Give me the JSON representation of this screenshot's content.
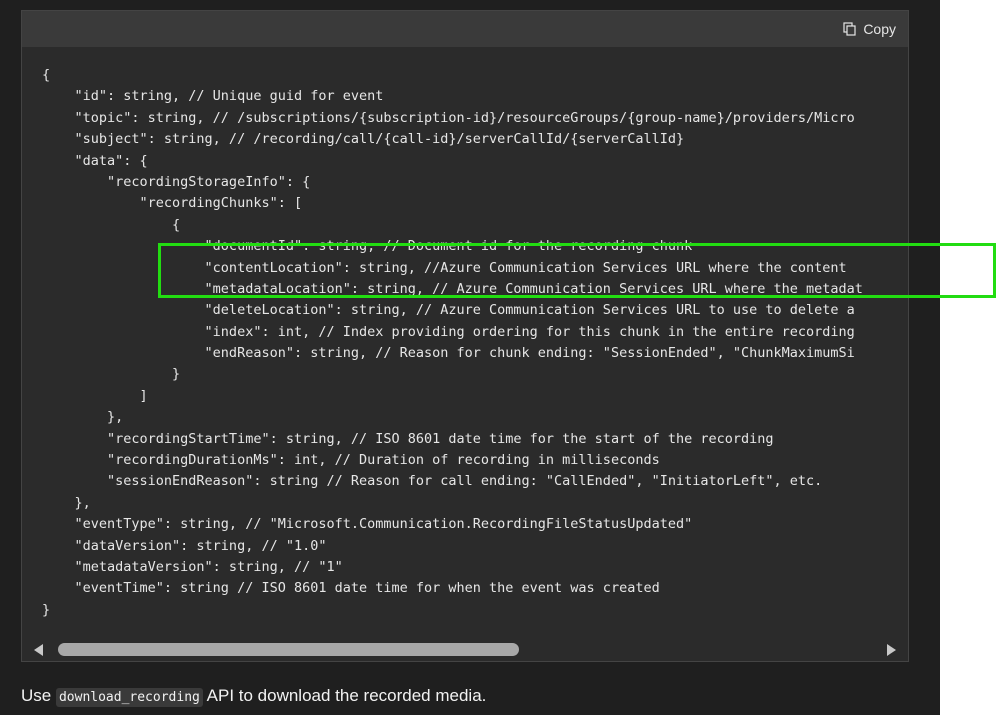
{
  "code_block": {
    "copy_label": "Copy",
    "copy_icon": "copy-icon",
    "lines": [
      "{",
      "    \"id\": string, // Unique guid for event",
      "    \"topic\": string, // /subscriptions/{subscription-id}/resourceGroups/{group-name}/providers/Micro",
      "    \"subject\": string, // /recording/call/{call-id}/serverCallId/{serverCallId}",
      "    \"data\": {",
      "        \"recordingStorageInfo\": {",
      "            \"recordingChunks\": [",
      "                {",
      "                    \"documentId\": string, // Document id for the recording chunk",
      "                    \"contentLocation\": string, //Azure Communication Services URL where the content",
      "                    \"metadataLocation\": string, // Azure Communication Services URL where the metadat",
      "                    \"deleteLocation\": string, // Azure Communication Services URL to use to delete a",
      "                    \"index\": int, // Index providing ordering for this chunk in the entire recording",
      "                    \"endReason\": string, // Reason for chunk ending: \"SessionEnded\", \"ChunkMaximumSi",
      "                }",
      "            ]",
      "        },",
      "        \"recordingStartTime\": string, // ISO 8601 date time for the start of the recording",
      "        \"recordingDurationMs\": int, // Duration of recording in milliseconds",
      "        \"sessionEndReason\": string // Reason for call ending: \"CallEnded\", \"InitiatorLeft\", etc.",
      "    },",
      "    \"eventType\": string, // \"Microsoft.Communication.RecordingFileStatusUpdated\"",
      "    \"dataVersion\": string, // \"1.0\"",
      "    \"metadataVersion\": string, // \"1\"",
      "    \"eventTime\": string // ISO 8601 date time for when the event was created",
      "}"
    ]
  },
  "footer": {
    "prefix": "Use ",
    "inline_code": "download_recording",
    "suffix": " API to download the recorded media."
  },
  "colors": {
    "highlight": "#22dd11",
    "background": "#1f1f1f",
    "code_background": "#2b2b2b"
  }
}
